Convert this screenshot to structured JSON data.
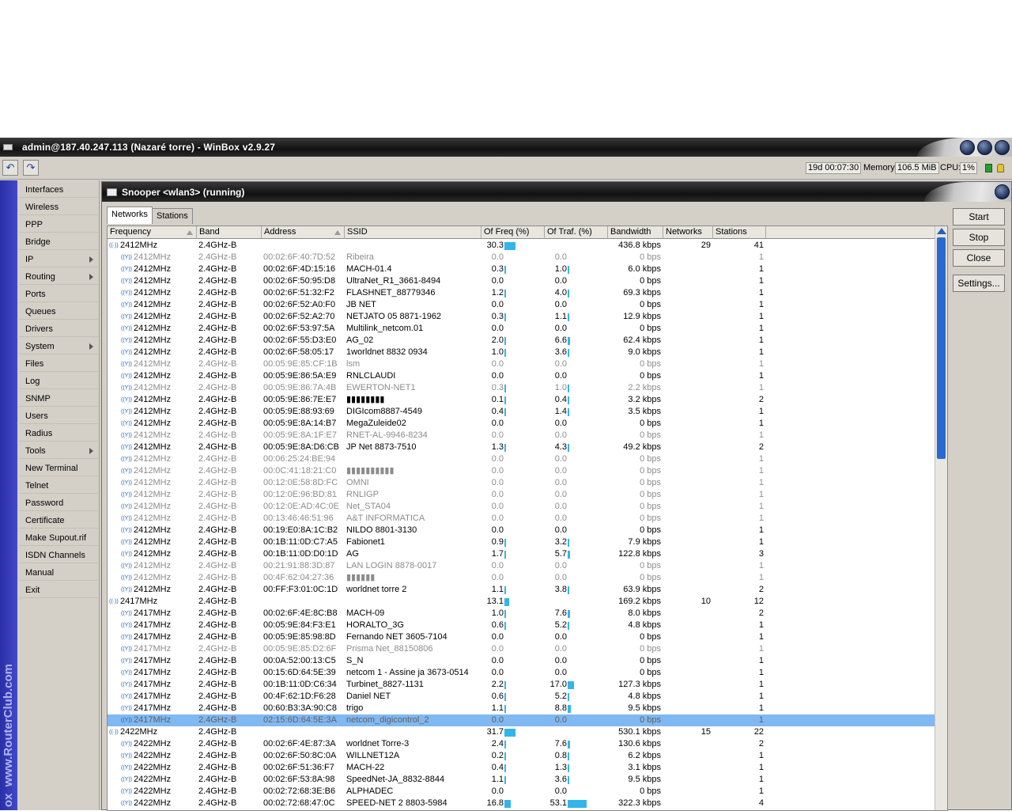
{
  "window": {
    "title": "admin@187.40.247.113 (Nazaré torre) - WinBox v2.9.27"
  },
  "toolbar": {
    "undo_icon": "undo-icon",
    "redo_icon": "redo-icon",
    "uptime": "19d 00:07:30",
    "memory_label": "Memory:",
    "memory_value": "106.5 MiB",
    "cpu_label": "CPU:",
    "cpu_value": "1%"
  },
  "sidebar": {
    "brand": "www.RouterClub.com",
    "brand_prefix": "ox",
    "items": [
      {
        "label": "Interfaces",
        "submenu": false
      },
      {
        "label": "Wireless",
        "submenu": false
      },
      {
        "label": "PPP",
        "submenu": false
      },
      {
        "label": "Bridge",
        "submenu": false
      },
      {
        "label": "IP",
        "submenu": true
      },
      {
        "label": "Routing",
        "submenu": true
      },
      {
        "label": "Ports",
        "submenu": false
      },
      {
        "label": "Queues",
        "submenu": false
      },
      {
        "label": "Drivers",
        "submenu": false
      },
      {
        "label": "System",
        "submenu": true
      },
      {
        "label": "Files",
        "submenu": false
      },
      {
        "label": "Log",
        "submenu": false
      },
      {
        "label": "SNMP",
        "submenu": false
      },
      {
        "label": "Users",
        "submenu": false
      },
      {
        "label": "Radius",
        "submenu": false
      },
      {
        "label": "Tools",
        "submenu": true
      },
      {
        "label": "New Terminal",
        "submenu": false
      },
      {
        "label": "Telnet",
        "submenu": false
      },
      {
        "label": "Password",
        "submenu": false
      },
      {
        "label": "Certificate",
        "submenu": false
      },
      {
        "label": "Make Supout.rif",
        "submenu": false
      },
      {
        "label": "ISDN Channels",
        "submenu": false
      },
      {
        "label": "Manual",
        "submenu": false
      },
      {
        "label": "Exit",
        "submenu": false
      }
    ]
  },
  "snooper": {
    "title": "Snooper <wlan3> (running)",
    "tabs": [
      "Networks",
      "Stations"
    ],
    "buttons": [
      "Start",
      "Stop",
      "Close",
      "Settings..."
    ],
    "columns": [
      "Frequency",
      "Band",
      "Address",
      "SSID",
      "Of Freq (%)",
      "Of Traf. (%)",
      "Bandwidth",
      "Networks",
      "Stations"
    ],
    "rows": [
      {
        "g": 1,
        "f": "2412MHz",
        "b": "2.4GHz-B",
        "a": "",
        "s": "",
        "of": "30.3",
        "ot": "",
        "bw": "436.8 kbps",
        "n": "29",
        "st": "41"
      },
      {
        "g": 0,
        "d": 1,
        "f": "2412MHz",
        "b": "2.4GHz-B",
        "a": "00:02:6F:40:7D:52",
        "s": "Ribeira",
        "of": "0.0",
        "ot": "0.0",
        "bw": "0 bps",
        "n": "",
        "st": "1"
      },
      {
        "g": 0,
        "f": "2412MHz",
        "b": "2.4GHz-B",
        "a": "00:02:6F:4D:15:16",
        "s": "MACH-01.4",
        "of": "0.3",
        "ot": "1.0",
        "bw": "6.0 kbps",
        "n": "",
        "st": "1"
      },
      {
        "g": 0,
        "f": "2412MHz",
        "b": "2.4GHz-B",
        "a": "00:02:6F:50:95:D8",
        "s": "UltraNet_R1_3661-8494",
        "of": "0.0",
        "ot": "0.0",
        "bw": "0 bps",
        "n": "",
        "st": "1"
      },
      {
        "g": 0,
        "f": "2412MHz",
        "b": "2.4GHz-B",
        "a": "00:02:6F:51:32:F2",
        "s": "FLASHNET_88779346",
        "of": "1.2",
        "ot": "4.0",
        "bw": "69.3 kbps",
        "n": "",
        "st": "1"
      },
      {
        "g": 0,
        "f": "2412MHz",
        "b": "2.4GHz-B",
        "a": "00:02:6F:52:A0:F0",
        "s": "JB NET",
        "of": "0.0",
        "ot": "0.0",
        "bw": "0 bps",
        "n": "",
        "st": "1"
      },
      {
        "g": 0,
        "f": "2412MHz",
        "b": "2.4GHz-B",
        "a": "00:02:6F:52:A2:70",
        "s": "NETJATO 05 8871-1962",
        "of": "0.3",
        "ot": "1.1",
        "bw": "12.9 kbps",
        "n": "",
        "st": "1"
      },
      {
        "g": 0,
        "f": "2412MHz",
        "b": "2.4GHz-B",
        "a": "00:02:6F:53:97:5A",
        "s": "Multilink_netcom.01",
        "of": "0.0",
        "ot": "0.0",
        "bw": "0 bps",
        "n": "",
        "st": "1"
      },
      {
        "g": 0,
        "f": "2412MHz",
        "b": "2.4GHz-B",
        "a": "00:02:6F:55:D3:E0",
        "s": "AG_02",
        "of": "2.0",
        "ot": "6.6",
        "bw": "62.4 kbps",
        "n": "",
        "st": "1"
      },
      {
        "g": 0,
        "f": "2412MHz",
        "b": "2.4GHz-B",
        "a": "00:02:6F:58:05:17",
        "s": "1worldnet 8832 0934",
        "of": "1.0",
        "ot": "3.6",
        "bw": "9.0 kbps",
        "n": "",
        "st": "1"
      },
      {
        "g": 0,
        "d": 1,
        "f": "2412MHz",
        "b": "2.4GHz-B",
        "a": "00:05:9E:85:CF:1B",
        "s": "lsm",
        "of": "0.0",
        "ot": "0.0",
        "bw": "0 bps",
        "n": "",
        "st": "1"
      },
      {
        "g": 0,
        "f": "2412MHz",
        "b": "2.4GHz-B",
        "a": "00:05:9E:86:5A:E9",
        "s": "RNLCLAUDI",
        "of": "0.0",
        "ot": "0.0",
        "bw": "0 bps",
        "n": "",
        "st": "1"
      },
      {
        "g": 0,
        "d": 1,
        "f": "2412MHz",
        "b": "2.4GHz-B",
        "a": "00:05:9E:86:7A:4B",
        "s": "EWERTON-NET1",
        "of": "0.3",
        "ot": "1.0",
        "bw": "2.2 kbps",
        "n": "",
        "st": "1"
      },
      {
        "g": 0,
        "f": "2412MHz",
        "b": "2.4GHz-B",
        "a": "00:05:9E:86:7E:E7",
        "s": "▮▮▮▮▮▮▮▮",
        "of": "0.1",
        "ot": "0.4",
        "bw": "3.2 kbps",
        "n": "",
        "st": "2"
      },
      {
        "g": 0,
        "f": "2412MHz",
        "b": "2.4GHz-B",
        "a": "00:05:9E:88:93:69",
        "s": "DIGIcom8887-4549",
        "of": "0.4",
        "ot": "1.4",
        "bw": "3.5 kbps",
        "n": "",
        "st": "1"
      },
      {
        "g": 0,
        "f": "2412MHz",
        "b": "2.4GHz-B",
        "a": "00:05:9E:8A:14:B7",
        "s": "MegaZuleide02",
        "of": "0.0",
        "ot": "0.0",
        "bw": "0 bps",
        "n": "",
        "st": "1"
      },
      {
        "g": 0,
        "d": 1,
        "f": "2412MHz",
        "b": "2.4GHz-B",
        "a": "00:05:9E:8A:1F:E7",
        "s": "RNET-AL-9946-8234",
        "of": "0.0",
        "ot": "0.0",
        "bw": "0 bps",
        "n": "",
        "st": "1"
      },
      {
        "g": 0,
        "f": "2412MHz",
        "b": "2.4GHz-B",
        "a": "00:05:9E:8A:D6:CB",
        "s": "JP Net 8873-7510",
        "of": "1.3",
        "ot": "4.3",
        "bw": "49.2 kbps",
        "n": "",
        "st": "2"
      },
      {
        "g": 0,
        "d": 1,
        "f": "2412MHz",
        "b": "2.4GHz-B",
        "a": "00:06:25:24:BE:94",
        "s": "",
        "of": "0.0",
        "ot": "0.0",
        "bw": "0 bps",
        "n": "",
        "st": "1"
      },
      {
        "g": 0,
        "d": 1,
        "f": "2412MHz",
        "b": "2.4GHz-B",
        "a": "00:0C:41:18:21:C0",
        "s": "▮▮▮▮▮▮▮▮▮▮",
        "of": "0.0",
        "ot": "0.0",
        "bw": "0 bps",
        "n": "",
        "st": "1"
      },
      {
        "g": 0,
        "d": 1,
        "f": "2412MHz",
        "b": "2.4GHz-B",
        "a": "00:12:0E:58:8D:FC",
        "s": "OMNI",
        "of": "0.0",
        "ot": "0.0",
        "bw": "0 bps",
        "n": "",
        "st": "1"
      },
      {
        "g": 0,
        "d": 1,
        "f": "2412MHz",
        "b": "2.4GHz-B",
        "a": "00:12:0E:96:BD:81",
        "s": "RNLIGP",
        "of": "0.0",
        "ot": "0.0",
        "bw": "0 bps",
        "n": "",
        "st": "1"
      },
      {
        "g": 0,
        "d": 1,
        "f": "2412MHz",
        "b": "2.4GHz-B",
        "a": "00:12:0E:AD:4C:0E",
        "s": "Net_STA04",
        "of": "0.0",
        "ot": "0.0",
        "bw": "0 bps",
        "n": "",
        "st": "1"
      },
      {
        "g": 0,
        "d": 1,
        "f": "2412MHz",
        "b": "2.4GHz-B",
        "a": "00:13:46:46:51:96",
        "s": "A&T INFORMATICA",
        "of": "0.0",
        "ot": "0.0",
        "bw": "0 bps",
        "n": "",
        "st": "1"
      },
      {
        "g": 0,
        "f": "2412MHz",
        "b": "2.4GHz-B",
        "a": "00:19:E0:8A:1C:B2",
        "s": "NILDO 8801-3130",
        "of": "0.0",
        "ot": "0.0",
        "bw": "0 bps",
        "n": "",
        "st": "1"
      },
      {
        "g": 0,
        "f": "2412MHz",
        "b": "2.4GHz-B",
        "a": "00:1B:11:0D:C7:A5",
        "s": "Fabionet1",
        "of": "0.9",
        "ot": "3.2",
        "bw": "7.9 kbps",
        "n": "",
        "st": "1"
      },
      {
        "g": 0,
        "f": "2412MHz",
        "b": "2.4GHz-B",
        "a": "00:1B:11:0D:D0:1D",
        "s": "AG",
        "of": "1.7",
        "ot": "5.7",
        "bw": "122.8 kbps",
        "n": "",
        "st": "3"
      },
      {
        "g": 0,
        "d": 1,
        "f": "2412MHz",
        "b": "2.4GHz-B",
        "a": "00:21:91:88:3D:87",
        "s": "LAN LOGIN 8878-0017",
        "of": "0.0",
        "ot": "0.0",
        "bw": "0 bps",
        "n": "",
        "st": "1"
      },
      {
        "g": 0,
        "d": 1,
        "f": "2412MHz",
        "b": "2.4GHz-B",
        "a": "00:4F:62:04:27:36",
        "s": "▮▮▮▮▮▮",
        "of": "0.0",
        "ot": "0.0",
        "bw": "0 bps",
        "n": "",
        "st": "1"
      },
      {
        "g": 0,
        "f": "2412MHz",
        "b": "2.4GHz-B",
        "a": "00:FF:F3:01:0C:1D",
        "s": "worldnet torre 2",
        "of": "1.1",
        "ot": "3.8",
        "bw": "63.9 kbps",
        "n": "",
        "st": "2"
      },
      {
        "g": 1,
        "f": "2417MHz",
        "b": "2.4GHz-B",
        "a": "",
        "s": "",
        "of": "13.1",
        "ot": "",
        "bw": "169.2 kbps",
        "n": "10",
        "st": "12"
      },
      {
        "g": 0,
        "f": "2417MHz",
        "b": "2.4GHz-B",
        "a": "00:02:6F:4E:8C:B8",
        "s": "MACH-09",
        "of": "1.0",
        "ot": "7.6",
        "bw": "8.0 kbps",
        "n": "",
        "st": "2"
      },
      {
        "g": 0,
        "f": "2417MHz",
        "b": "2.4GHz-B",
        "a": "00:05:9E:84:F3:E1",
        "s": "HORALTO_3G",
        "of": "0.6",
        "ot": "5.2",
        "bw": "4.8 kbps",
        "n": "",
        "st": "1"
      },
      {
        "g": 0,
        "f": "2417MHz",
        "b": "2.4GHz-B",
        "a": "00:05:9E:85:98:8D",
        "s": "Fernando NET 3605-7104",
        "of": "0.0",
        "ot": "0.0",
        "bw": "0 bps",
        "n": "",
        "st": "1"
      },
      {
        "g": 0,
        "d": 1,
        "f": "2417MHz",
        "b": "2.4GHz-B",
        "a": "00:05:9E:85:D2:6F",
        "s": "Prisma Net_88150806",
        "of": "0.0",
        "ot": "0.0",
        "bw": "0 bps",
        "n": "",
        "st": "1"
      },
      {
        "g": 0,
        "f": "2417MHz",
        "b": "2.4GHz-B",
        "a": "00:0A:52:00:13:C5",
        "s": "S_N",
        "of": "0.0",
        "ot": "0.0",
        "bw": "0 bps",
        "n": "",
        "st": "1"
      },
      {
        "g": 0,
        "f": "2417MHz",
        "b": "2.4GHz-B",
        "a": "00:15:6D:64:5E:39",
        "s": "netcom 1 - Assine ja 3673-0514",
        "of": "0.0",
        "ot": "0.0",
        "bw": "0 bps",
        "n": "",
        "st": "1"
      },
      {
        "g": 0,
        "f": "2417MHz",
        "b": "2.4GHz-B",
        "a": "00:1B:11:0D:C6:34",
        "s": "Turbinet_8827-1131",
        "of": "2.2",
        "ot": "17.0",
        "bw": "127.3 kbps",
        "n": "",
        "st": "1"
      },
      {
        "g": 0,
        "f": "2417MHz",
        "b": "2.4GHz-B",
        "a": "00:4F:62:1D:F6:28",
        "s": "Daniel NET",
        "of": "0.6",
        "ot": "5.2",
        "bw": "4.8 kbps",
        "n": "",
        "st": "1"
      },
      {
        "g": 0,
        "f": "2417MHz",
        "b": "2.4GHz-B",
        "a": "00:60:B3:3A:90:C8",
        "s": "trigo",
        "of": "1.1",
        "ot": "8.8",
        "bw": "9.5 kbps",
        "n": "",
        "st": "1"
      },
      {
        "g": 0,
        "d": 1,
        "sel": 1,
        "f": "2417MHz",
        "b": "2.4GHz-B",
        "a": "02:15:6D:64:5E:3A",
        "s": "netcom_digicontrol_2",
        "of": "0.0",
        "ot": "0.0",
        "bw": "0 bps",
        "n": "",
        "st": "1"
      },
      {
        "g": 1,
        "f": "2422MHz",
        "b": "2.4GHz-B",
        "a": "",
        "s": "",
        "of": "31.7",
        "ot": "",
        "bw": "530.1 kbps",
        "n": "15",
        "st": "22"
      },
      {
        "g": 0,
        "f": "2422MHz",
        "b": "2.4GHz-B",
        "a": "00:02:6F:4E:87:3A",
        "s": "worldnet Torre-3",
        "of": "2.4",
        "ot": "7.6",
        "bw": "130.6 kbps",
        "n": "",
        "st": "2"
      },
      {
        "g": 0,
        "f": "2422MHz",
        "b": "2.4GHz-B",
        "a": "00:02:6F:50:8C:0A",
        "s": "WILLNET12A",
        "of": "0.2",
        "ot": "0.8",
        "bw": "6.2 kbps",
        "n": "",
        "st": "1"
      },
      {
        "g": 0,
        "f": "2422MHz",
        "b": "2.4GHz-B",
        "a": "00:02:6F:51:36:F7",
        "s": "MACH-22",
        "of": "0.4",
        "ot": "1.3",
        "bw": "3.1 kbps",
        "n": "",
        "st": "1"
      },
      {
        "g": 0,
        "f": "2422MHz",
        "b": "2.4GHz-B",
        "a": "00:02:6F:53:8A:98",
        "s": "SpeedNet-JA_8832-8844",
        "of": "1.1",
        "ot": "3.6",
        "bw": "9.5 kbps",
        "n": "",
        "st": "1"
      },
      {
        "g": 0,
        "f": "2422MHz",
        "b": "2.4GHz-B",
        "a": "00:02:72:68:3E:B6",
        "s": "ALPHADEC",
        "of": "0.0",
        "ot": "0.0",
        "bw": "0 bps",
        "n": "",
        "st": "1"
      },
      {
        "g": 0,
        "f": "2422MHz",
        "b": "2.4GHz-B",
        "a": "00:02:72:68:47:0C",
        "s": "SPEED-NET 2 8803-5984",
        "of": "16.8",
        "ot": "53.1",
        "bw": "322.3 kbps",
        "n": "",
        "st": "4"
      }
    ]
  }
}
